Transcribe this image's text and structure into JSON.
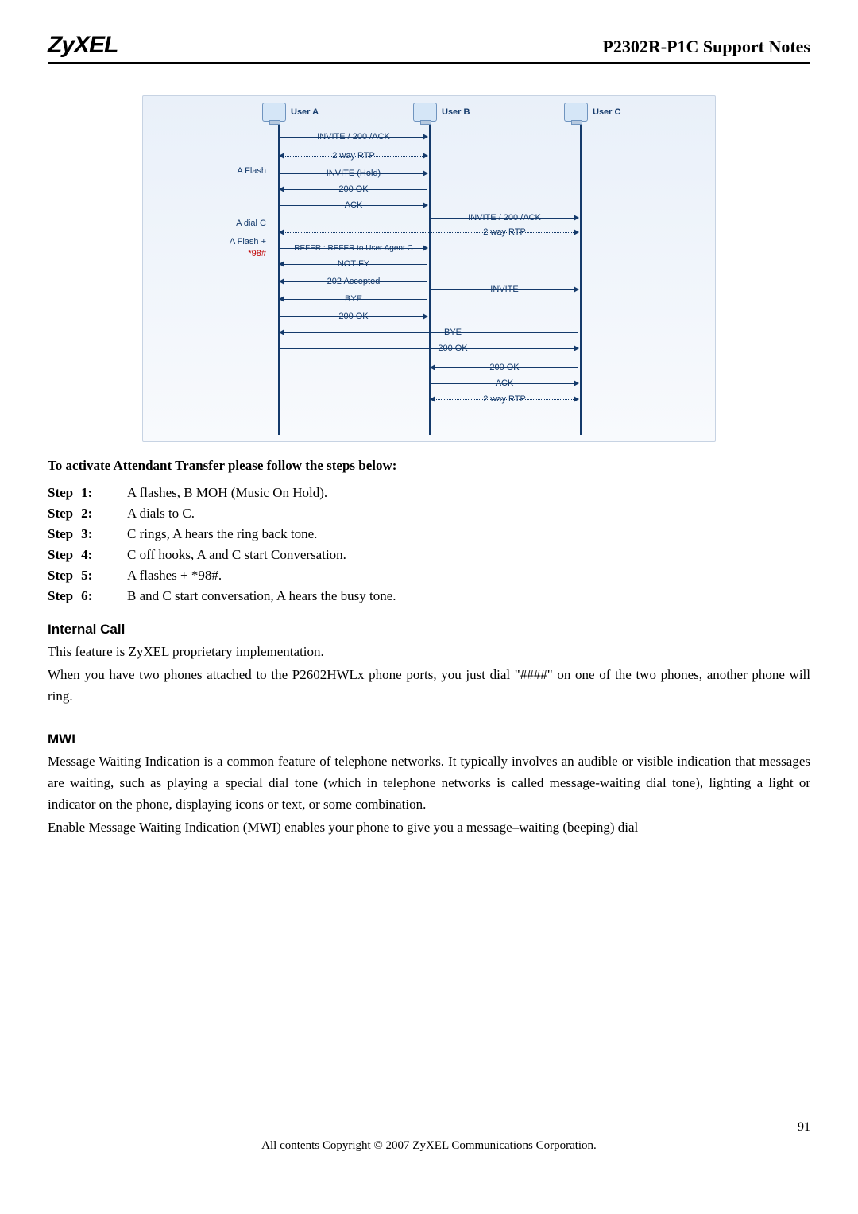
{
  "header": {
    "logo": "ZyXEL",
    "title": "P2302R-P1C Support Notes"
  },
  "diagram": {
    "users": {
      "a": "User A",
      "b": "User B",
      "c": "User C"
    },
    "side_notes": {
      "flash": "A Flash",
      "dialc": "A dial C",
      "flash98_line1": "A Flash +",
      "flash98_line2": "*98#"
    },
    "msgs": {
      "invite200ack_ab": "INVITE / 200 /ACK",
      "tworrtp_ab1": "2 way RTP",
      "invite_hold": "INVITE (Hold)",
      "ok200_1": "200 OK",
      "ack1": "ACK",
      "invite200ack_bc": "INVITE / 200 /ACK",
      "tworrtp_ac1": "2 way RTP",
      "refer": "REFER : REFER to User Agent C",
      "notify": "NOTIFY",
      "accepted202": "202 Accepted",
      "bye1": "BYE",
      "invite_bc": "INVITE",
      "ok200_2": "200 OK",
      "bye_ac": "BYE",
      "ok200_ac": "200 OK",
      "ok200_bc": "200 OK",
      "ack_bc": "ACK",
      "tworrtp_bc": "2 way RTP"
    }
  },
  "activate_heading": "To activate Attendant Transfer please follow the steps below:",
  "steps": [
    {
      "prefix": "Step",
      "num": "1:",
      "text": "A flashes, B MOH (Music On Hold)."
    },
    {
      "prefix": "Step",
      "num": "2:",
      "text": "A dials to C."
    },
    {
      "prefix": "Step",
      "num": "3:",
      "text": "C rings, A hears the ring back tone."
    },
    {
      "prefix": "Step",
      "num": "4:",
      "text": "C off hooks, A and C start Conversation."
    },
    {
      "prefix": "Step",
      "num": "5:",
      "text": "A flashes + *98#."
    },
    {
      "prefix": "Step",
      "num": "6:",
      "text": "B and C start conversation, A hears the busy tone."
    }
  ],
  "sections": {
    "internal_call": {
      "title": "Internal Call",
      "p1": "This feature is ZyXEL proprietary implementation.",
      "p2": "When you have two phones attached to the P2602HWLx phone ports, you just dial \"####\" on one of the two phones, another phone will ring."
    },
    "mwi": {
      "title": "MWI",
      "p1": "Message Waiting Indication is a common feature of telephone networks. It typically involves an audible or visible indication that messages are waiting, such as playing a special dial tone (which in telephone networks is called message-waiting dial tone), lighting a light or indicator on the phone, displaying icons or text, or some combination.",
      "p2": "Enable Message Waiting Indication (MWI) enables your phone to give you a message–waiting (beeping) dial"
    }
  },
  "footer": {
    "pagenum": "91",
    "copyright": "All contents Copyright © 2007 ZyXEL Communications Corporation."
  }
}
